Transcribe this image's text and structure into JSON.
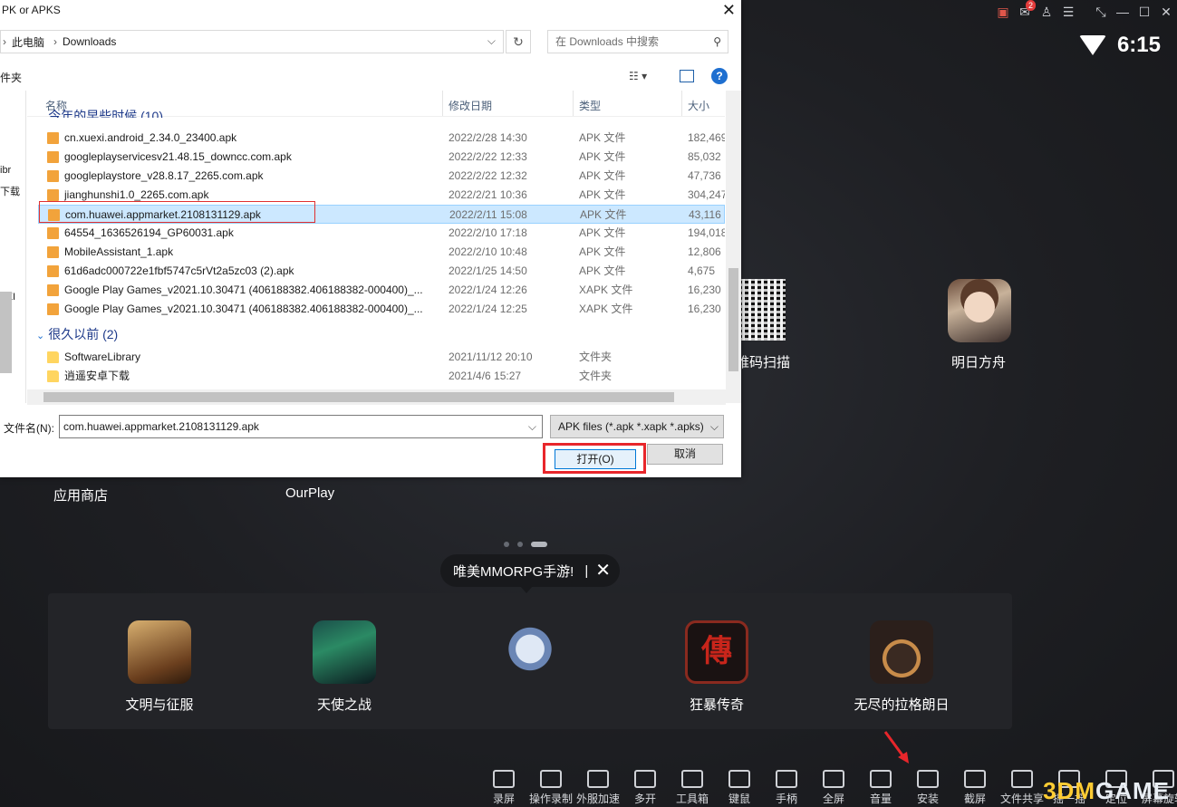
{
  "emulator": {
    "topbar_icons": [
      "gift-icon",
      "mail-icon",
      "user-icon",
      "menu-icon",
      "resize-icon",
      "minimize-icon",
      "maximize-icon",
      "close-icon"
    ],
    "mail_badge": "2",
    "time": "6:15"
  },
  "desktop": {
    "apps": [
      {
        "label": "维码扫描"
      },
      {
        "label": "明日方舟"
      },
      {
        "label": "应用商店"
      },
      {
        "label": "OurPlay"
      }
    ],
    "bubble_text": "唯美MMORPG手游!",
    "bubble_sep": "|",
    "dock": [
      {
        "label": "文明与征服"
      },
      {
        "label": "天使之战"
      },
      {
        "label": ""
      },
      {
        "label": "狂暴传奇"
      },
      {
        "label": "无尽的拉格朗日"
      }
    ],
    "dock_icon4_glyph": "傳",
    "toolbar": [
      {
        "label": "录屏",
        "icon": "record-icon"
      },
      {
        "label": "操作录制",
        "icon": "macro-icon"
      },
      {
        "label": "外服加速",
        "icon": "rocket-icon"
      },
      {
        "label": "多开",
        "icon": "multi-instance-icon"
      },
      {
        "label": "工具箱",
        "icon": "toolbox-icon"
      },
      {
        "label": "键鼠",
        "icon": "keyboard-icon"
      },
      {
        "label": "手柄",
        "icon": "gamepad-icon"
      },
      {
        "label": "全屏",
        "icon": "fullscreen-icon"
      },
      {
        "label": "音量",
        "icon": "volume-icon"
      },
      {
        "label": "安装",
        "icon": "apk-install-icon"
      },
      {
        "label": "截屏",
        "icon": "screenshot-icon"
      },
      {
        "label": "文件共享",
        "icon": "share-icon"
      },
      {
        "label": "摇一摇",
        "icon": "shake-icon"
      },
      {
        "label": "定位",
        "icon": "location-icon"
      },
      {
        "label": "屏幕旋转",
        "icon": "rotate-icon"
      }
    ],
    "watermark_a": "3DM",
    "watermark_b": "GAME"
  },
  "dialog": {
    "title": "PK or APKS",
    "breadcrumb": [
      "此电脑",
      "Downloads"
    ],
    "search_placeholder": "在 Downloads 中搜索",
    "nav_label": "件夹",
    "nav_fragments": [
      "ibr",
      "下载",
      "TEI",
      ":)",
      ":)"
    ],
    "columns": {
      "name": "名称",
      "date": "修改日期",
      "type": "类型",
      "size": "大小"
    },
    "groups": [
      {
        "label": "今年的早些时候 (10)"
      },
      {
        "label": "很久以前 (2)"
      }
    ],
    "files": [
      {
        "name": "cn.xuexi.android_2.34.0_23400.apk",
        "date": "2022/2/28 14:30",
        "type": "APK 文件",
        "size": "182,469"
      },
      {
        "name": "googleplayservicesv21.48.15_downcc.com.apk",
        "date": "2022/2/22 12:33",
        "type": "APK 文件",
        "size": "85,032"
      },
      {
        "name": "googleplaystore_v28.8.17_2265.com.apk",
        "date": "2022/2/22 12:32",
        "type": "APK 文件",
        "size": "47,736"
      },
      {
        "name": "jianghunshi1.0_2265.com.apk",
        "date": "2022/2/21 10:36",
        "type": "APK 文件",
        "size": "304,247"
      },
      {
        "name": "com.huawei.appmarket.2108131129.apk",
        "date": "2022/2/11 15:08",
        "type": "APK 文件",
        "size": "43,116"
      },
      {
        "name": "64554_1636526194_GP60031.apk",
        "date": "2022/2/10 17:18",
        "type": "APK 文件",
        "size": "194,018"
      },
      {
        "name": "MobileAssistant_1.apk",
        "date": "2022/2/10 10:48",
        "type": "APK 文件",
        "size": "12,806"
      },
      {
        "name": "61d6adc000722e1fbf5747c5rVt2a5zc03 (2).apk",
        "date": "2022/1/25 14:50",
        "type": "APK 文件",
        "size": "4,675"
      },
      {
        "name": "Google Play Games_v2021.10.30471 (406188382.406188382-000400)_...",
        "date": "2022/1/24 12:26",
        "type": "XAPK 文件",
        "size": "16,230"
      },
      {
        "name": "Google Play Games_v2021.10.30471 (406188382.406188382-000400)_...",
        "date": "2022/1/24 12:25",
        "type": "XAPK 文件",
        "size": "16,230"
      }
    ],
    "folders": [
      {
        "name": "SoftwareLibrary",
        "date": "2021/11/12 20:10",
        "type": "文件夹"
      },
      {
        "name": "逍遥安卓下载",
        "date": "2021/4/6 15:27",
        "type": "文件夹"
      }
    ],
    "filename_label": "文件名(N):",
    "filename_value": "com.huawei.appmarket.2108131129.apk",
    "filter_value": "APK files (*.apk *.xapk *.apks)",
    "open_label": "打开(O)",
    "cancel_label": "取消"
  },
  "colors": {
    "accent": "#0078d7",
    "highlight_red": "#e8262b",
    "selection": "#cce8ff"
  }
}
